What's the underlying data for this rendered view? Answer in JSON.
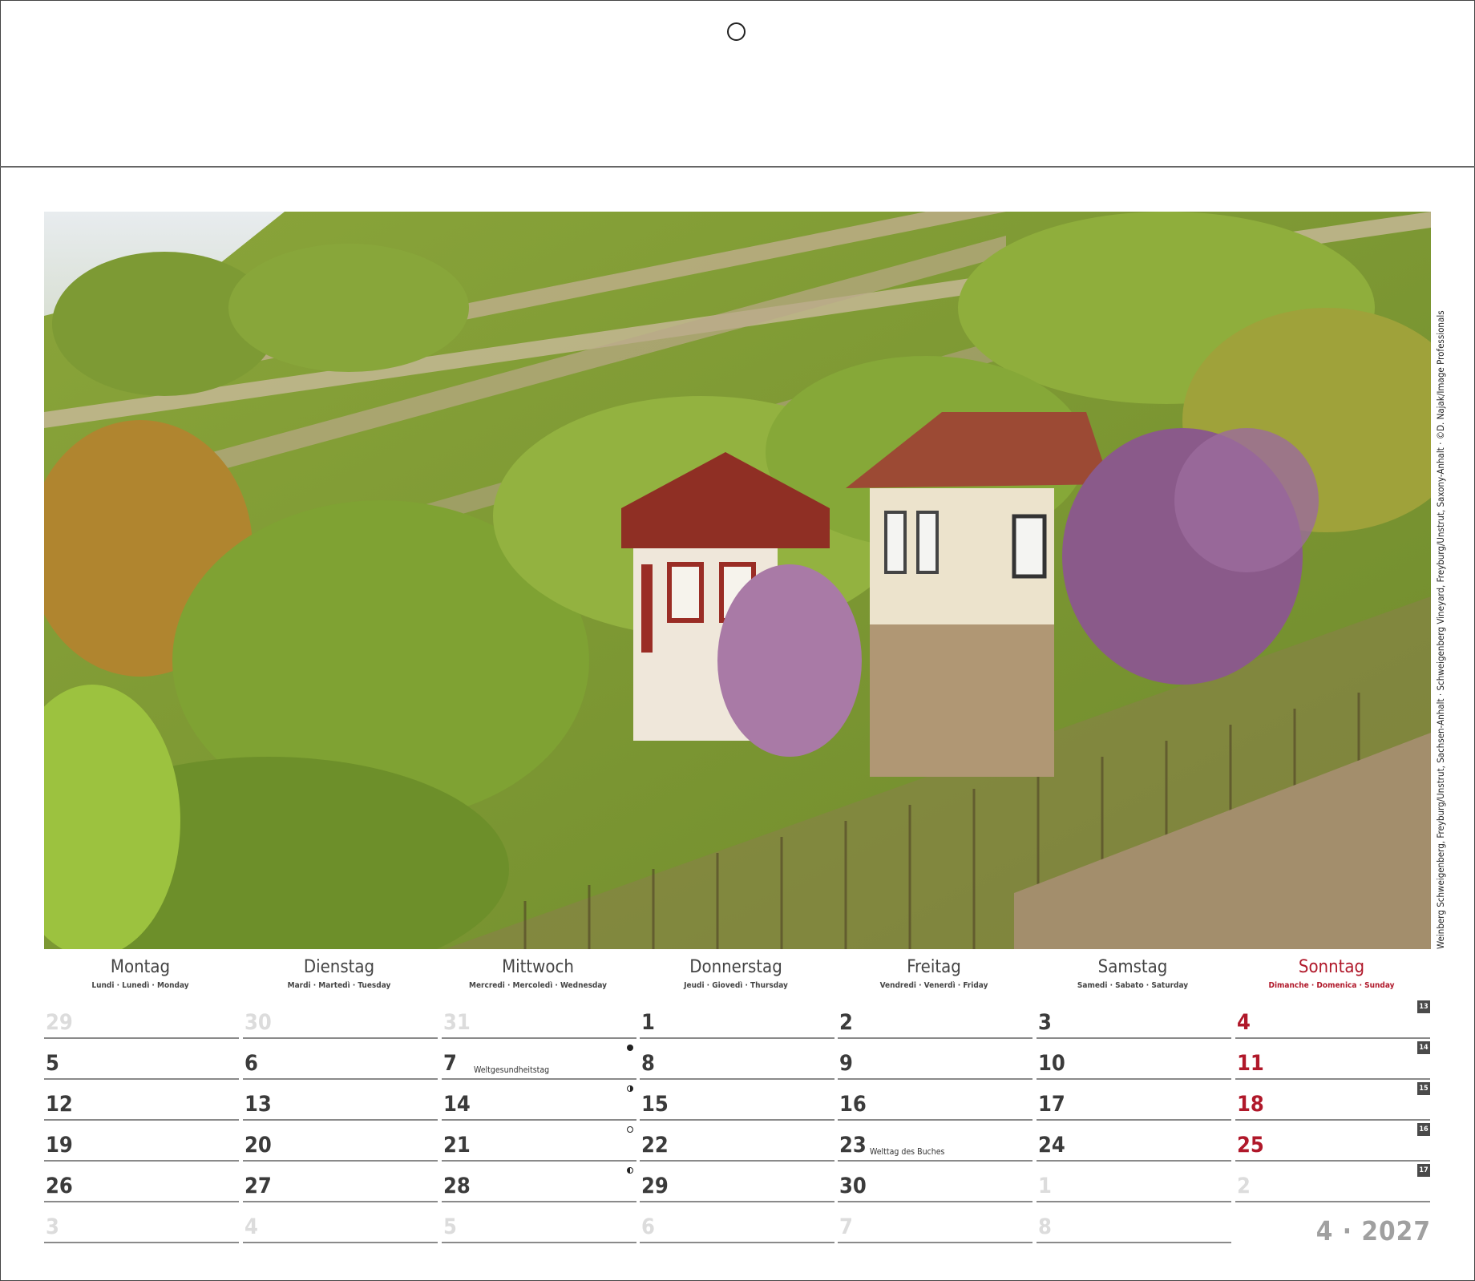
{
  "photo": {
    "description_icon": "vineyard-photo",
    "credit": "Weinberg Schweigenberg, Freyburg/Unstrut, Sachsen-Anhalt · Schweigenberg Vineyard, Freyburg/Unstrut, Saxony-Anhalt · ©D. Najak/Image Professionals"
  },
  "weekdays": [
    {
      "name": "Montag",
      "sub": "Lundi · Lunedì · Monday"
    },
    {
      "name": "Dienstag",
      "sub": "Mardi · Martedì · Tuesday"
    },
    {
      "name": "Mittwoch",
      "sub": "Mercredi · Mercoledì · Wednesday"
    },
    {
      "name": "Donnerstag",
      "sub": "Jeudi · Giovedì · Thursday"
    },
    {
      "name": "Freitag",
      "sub": "Vendredi · Venerdì · Friday"
    },
    {
      "name": "Samstag",
      "sub": "Samedi · Sabato · Saturday"
    },
    {
      "name": "Sonntag",
      "sub": "Dimanche · Domenica · Sunday"
    }
  ],
  "weeks": [
    {
      "week": "13",
      "days": [
        "29",
        "30",
        "31",
        "1",
        "2",
        "3",
        "4"
      ]
    },
    {
      "week": "14",
      "days": [
        "5",
        "6",
        "7",
        "8",
        "9",
        "10",
        "11"
      ]
    },
    {
      "week": "15",
      "days": [
        "12",
        "13",
        "14",
        "15",
        "16",
        "17",
        "18"
      ]
    },
    {
      "week": "16",
      "days": [
        "19",
        "20",
        "21",
        "22",
        "23",
        "24",
        "25"
      ]
    },
    {
      "week": "17",
      "days": [
        "26",
        "27",
        "28",
        "29",
        "30",
        "1",
        "2"
      ]
    },
    {
      "week": "",
      "days": [
        "3",
        "4",
        "5",
        "6",
        "7",
        "8",
        ""
      ]
    }
  ],
  "notes": {
    "w1d2": "Weltgesundheitstag",
    "w3d4": "Welttag des Buches"
  },
  "moons": {
    "w1d2": "new",
    "w2d2": "firstq",
    "w3d2": "full",
    "w4d2": "lastq"
  },
  "month_label": "4 · 2027",
  "colors": {
    "sunday": "#b0182a",
    "text": "#3b3b3b",
    "muted": "#dcdcdc"
  }
}
